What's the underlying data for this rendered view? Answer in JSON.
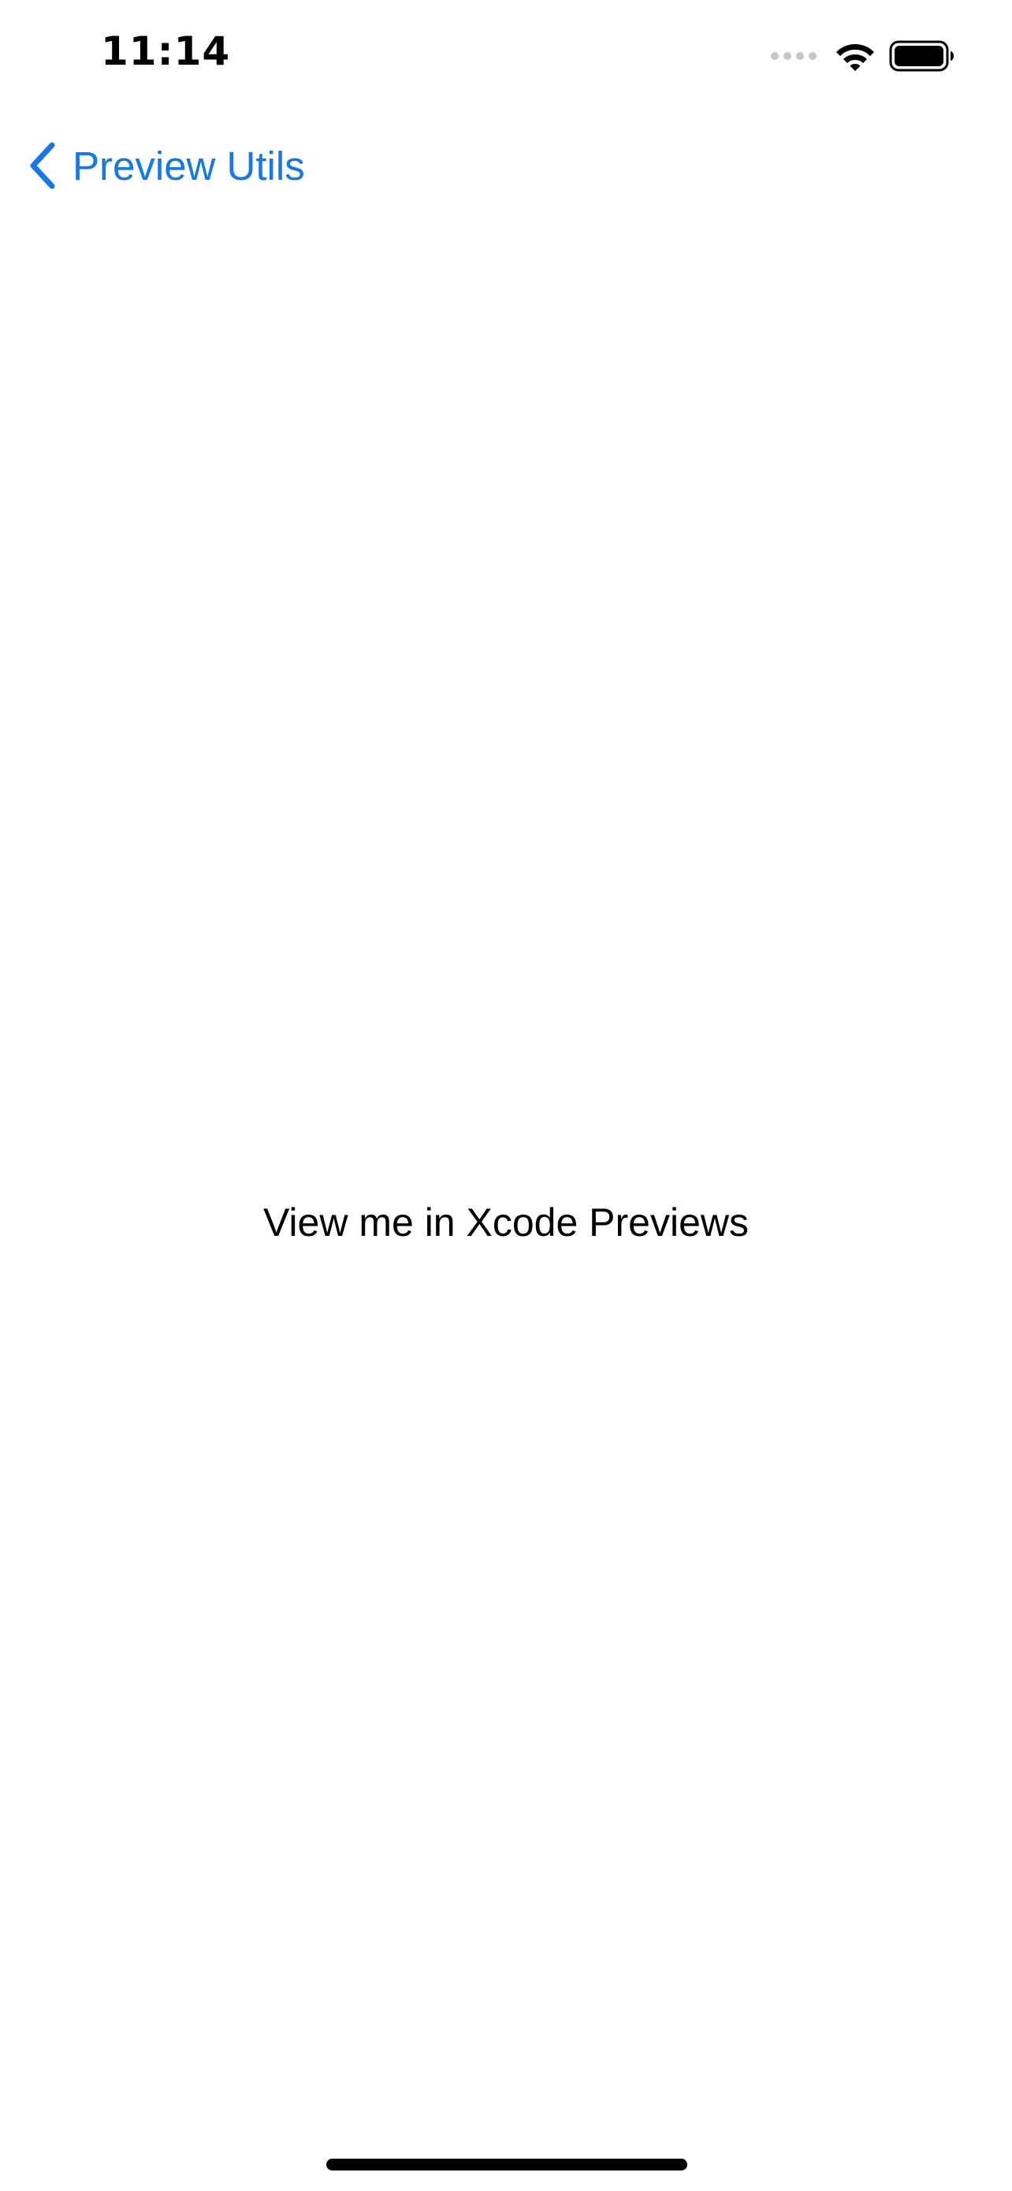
{
  "status_bar": {
    "time": "11:14",
    "icons": [
      "cellular-signal-icon",
      "wifi-icon",
      "battery-icon"
    ]
  },
  "nav": {
    "back_label": "Preview Utils",
    "back_icon": "chevron-left-icon",
    "accent_color": "#1677e6"
  },
  "content": {
    "message": "View me in Xcode Previews"
  }
}
